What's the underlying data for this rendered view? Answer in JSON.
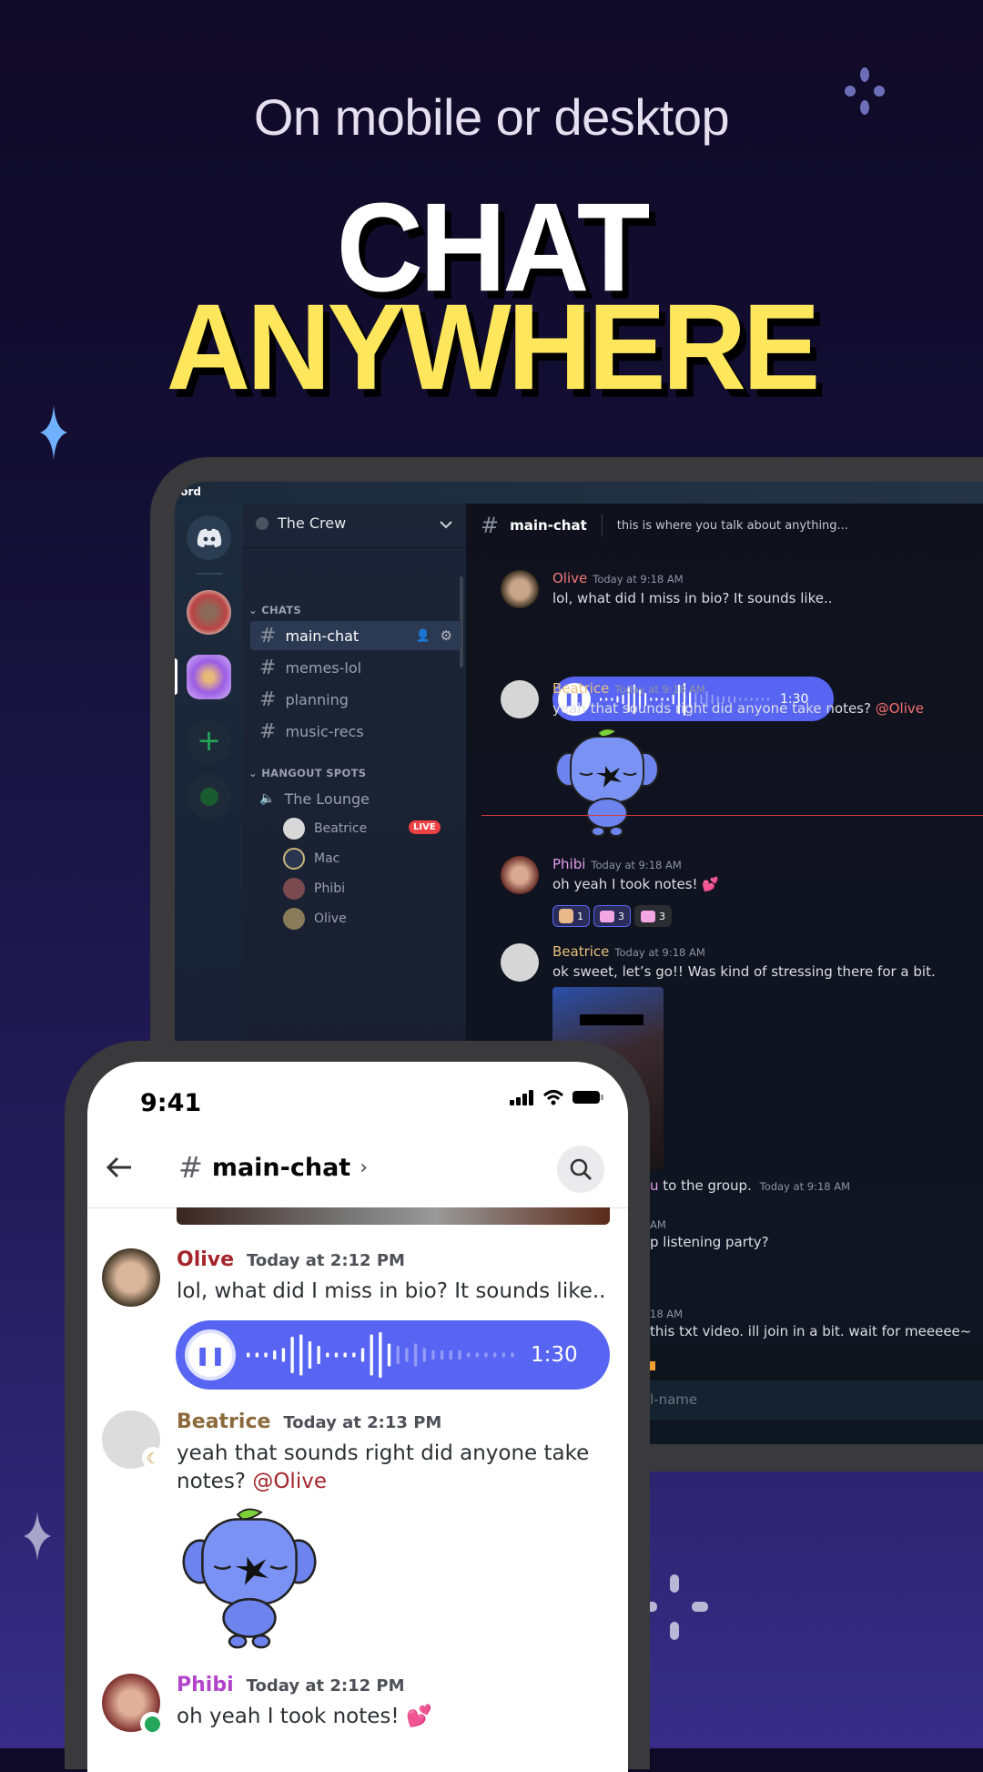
{
  "hero": {
    "subtitle": "On mobile or desktop",
    "line1": "CHAT",
    "line2": "ANYWHERE"
  },
  "colors": {
    "accent": "#5865f2",
    "headline_yellow": "#fee75c",
    "live": "#ed4245",
    "mention_desktop": "#f87171",
    "mention_mobile": "#a4262c"
  },
  "desktop": {
    "app_title": "scord",
    "server_name": "The Crew",
    "channel_header": {
      "name": "main-chat",
      "topic": "this is where you talk about anything..."
    },
    "sections": [
      {
        "label": "CHATS",
        "channels": [
          {
            "name": "main-chat",
            "selected": true
          },
          {
            "name": "memes-lol"
          },
          {
            "name": "planning"
          },
          {
            "name": "music-recs"
          }
        ]
      },
      {
        "label": "HANGOUT SPOTS",
        "voice_channel": "The Lounge",
        "users": [
          {
            "name": "Beatrice",
            "badge": "LIVE"
          },
          {
            "name": "Mac"
          },
          {
            "name": "Phibi"
          },
          {
            "name": "Olive"
          }
        ]
      }
    ],
    "messages": [
      {
        "author": "Olive",
        "color": "#f47b7b",
        "time": "Today at 9:18 AM",
        "text": "lol, what did I miss in bio? It sounds like..",
        "voice_duration": "1:30"
      },
      {
        "author": "Beatrice",
        "color": "#e8c07a",
        "time": "Today at 9:18 AM",
        "text": "yeah that sounds right did anyone take notes?",
        "mention": "@Olive"
      },
      {
        "author": "Phibi",
        "color": "#e59cf0",
        "time": "Today at 9:18 AM",
        "text": "oh yeah I took notes!",
        "reactions": [
          {
            "emoji": "anime-girl",
            "count": "1"
          },
          {
            "emoji": "pink-cat",
            "count": "3"
          },
          {
            "emoji": "pink-cat-2",
            "count": "3"
          }
        ]
      },
      {
        "author": "Beatrice",
        "color": "#e8c07a",
        "time": "Today at 9:18 AM",
        "text": "ok sweet, let’s go!! Was kind of stressing there for a bit."
      }
    ],
    "partial": {
      "join_user_tail": "u",
      "join_text": "to the group.",
      "join_time": "Today at 9:18 AM",
      "ts_tail_1": "AM",
      "text_tail_1": "p listening party?",
      "ts_tail_2": "18 AM",
      "text_tail_2": "this txt video. ill join in a bit. wait for meeeee~",
      "input_placeholder_tail": "l-name"
    }
  },
  "mobile": {
    "status_time": "9:41",
    "channel": "main-chat",
    "messages": [
      {
        "author": "Olive",
        "color": "#a4262c",
        "time": "Today at 2:12 PM",
        "text": "lol, what did I miss in bio? It sounds like..",
        "voice_duration": "1:30"
      },
      {
        "author": "Beatrice",
        "color": "#8c6a3c",
        "time": "Today at 2:13 PM",
        "text": "yeah that sounds right did anyone take notes?",
        "mention": "@Olive",
        "status": "idle"
      },
      {
        "author": "Phibi",
        "color": "#b144c8",
        "time": "Today at 2:12 PM",
        "text": "oh yeah I took notes!",
        "status": "online"
      }
    ]
  }
}
